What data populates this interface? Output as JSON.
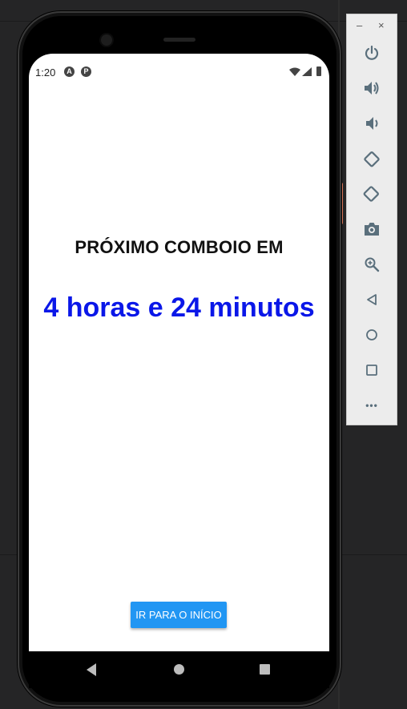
{
  "status_bar": {
    "time": "1:20",
    "icon_a": "A",
    "icon_b": "P"
  },
  "app": {
    "heading": "PRÓXIMO COMBOIO EM",
    "countdown": "4 horas e 24 minutos",
    "home_button_label": "IR PARA O INÍCIO"
  },
  "emulator_toolbar": {
    "minimize_label": "–",
    "close_label": "×",
    "more_label": "•••",
    "buttons": [
      {
        "name": "power",
        "icon": "power-icon"
      },
      {
        "name": "volume-up",
        "icon": "volume-up-icon"
      },
      {
        "name": "volume-down",
        "icon": "volume-down-icon"
      },
      {
        "name": "rotate-left",
        "icon": "rotate-left-icon"
      },
      {
        "name": "rotate-right",
        "icon": "rotate-right-icon"
      },
      {
        "name": "screenshot",
        "icon": "camera-icon"
      },
      {
        "name": "zoom",
        "icon": "zoom-icon"
      },
      {
        "name": "back",
        "icon": "back-icon"
      },
      {
        "name": "home",
        "icon": "home-icon"
      },
      {
        "name": "overview",
        "icon": "overview-icon"
      },
      {
        "name": "more",
        "icon": "more-icon"
      }
    ]
  },
  "colors": {
    "countdown": "#0a17e8",
    "button": "#2196f3",
    "icon": "#5a6f7c"
  }
}
